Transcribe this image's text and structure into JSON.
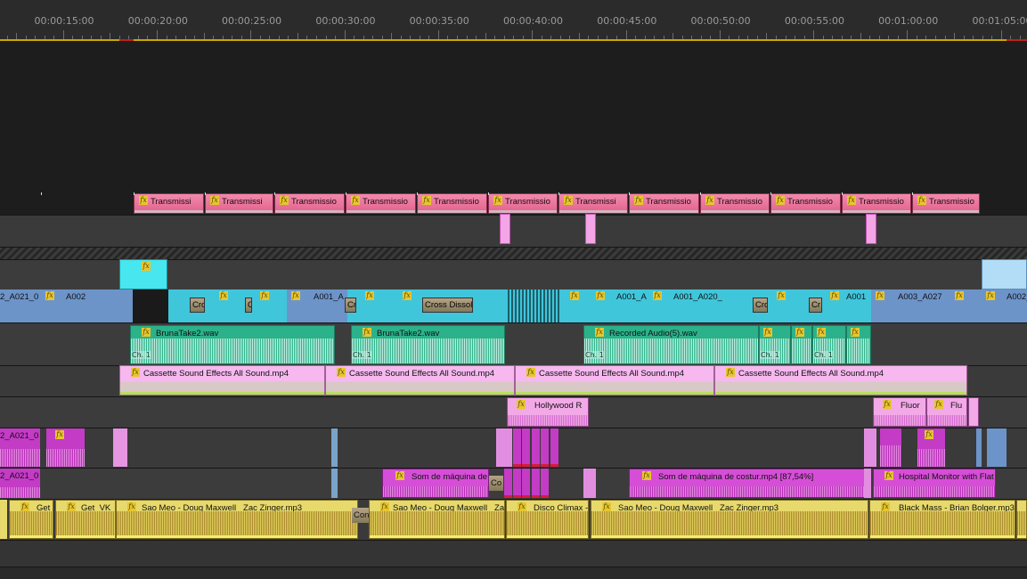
{
  "timeline": {
    "timecodes": [
      "00:00:15:00",
      "00:00:20:00",
      "00:00:25:00",
      "00:00:30:00",
      "00:00:35:00",
      "00:00:40:00",
      "00:00:45:00",
      "00:00:50:00",
      "00:00:55:00",
      "00:01:00:00",
      "00:01:05:00"
    ]
  },
  "fx_badge": "fx",
  "clip_labels": {
    "transmission": "Transmissio",
    "transmission_short": "Transmissi",
    "v_a021": "2_A021_0",
    "v_a002": "A002",
    "v_a001a": "A001_A",
    "v_a001a_2": "A001_A",
    "v_a001a020": "A001_A020_",
    "v_a001": "A001",
    "v_a003": "A003_A027",
    "v_a002b": "A002_",
    "cross": "Cro",
    "cross_c": "C",
    "cross_cr": "Cr",
    "cross_dissolve": "Cross Dissolv",
    "bruna1": "BrunaTake2.wav",
    "bruna2": "BrunaTake2.wav",
    "recorded": "Recorded Audio(5).wav",
    "ch1": "Ch. 1",
    "cassette": "Cassette Sound Effects All Sound.mp4",
    "hollywood": "Hollywood R",
    "fluor": "Fluor",
    "flu": "Flu",
    "a021_b": "2_A021_0",
    "a021_c": "2_A021_0",
    "som1": "Som de máquina de",
    "som2": "Som de máquina de costur.mp4 [87,54%]",
    "hospital": "Hospital Monitor with Flat",
    "co": "Co",
    "get": "Get",
    "get_vk": "Get_VK",
    "sao_meo_full": "Sao Meo - Doug Maxwell_ Zac Zinger.mp3",
    "sao_meo_short": "Sao Meo - Doug Maxwell_ Za",
    "con": "Con",
    "disco": "Disco Climax -",
    "black_mass": "Black Mass - Brian Bolger.mp3"
  },
  "colors": {
    "pink_title": "#e76b96",
    "cyan_video": "#3fc6db",
    "blue_video": "#6d94c9",
    "green_audio": "#2bb28a",
    "light_pink": "#f2a9e6",
    "magenta": "#c43bc6",
    "yellow_audio": "#d9c947",
    "cursor_yellow": "#c9a800",
    "marker_red": "#c0201a"
  }
}
